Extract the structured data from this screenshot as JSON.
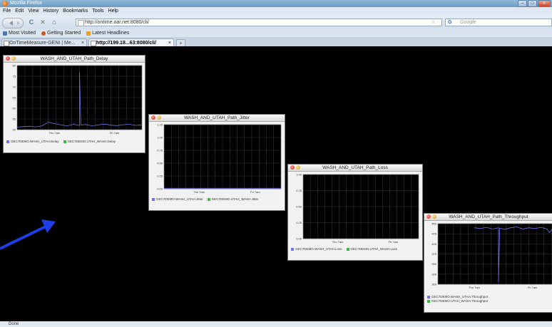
{
  "window": {
    "title": "Mozilla Firefox",
    "buttons": [
      "–",
      "□",
      "✕"
    ]
  },
  "menu": [
    "File",
    "Edit",
    "View",
    "History",
    "Bookmarks",
    "Tools",
    "Help"
  ],
  "nav": {
    "back_icon": "back-arrow-icon",
    "reload_glyph": "C",
    "stop_glyph": "✕",
    "home_glyph": "⌂",
    "url": "http://ontime.oar.net:8080/cli/",
    "bookmark_star": "☆ ·",
    "search_engine": "G",
    "search_placeholder": "Google"
  },
  "bookmarks": [
    {
      "label": "Most Visited",
      "icon": "most-visited-icon",
      "color": "#4a78b5"
    },
    {
      "label": "Getting Started",
      "icon": "firefox-icon",
      "color": "#d2541c"
    },
    {
      "label": "Latest Headlines",
      "icon": "rss-icon",
      "color": "#f0a020"
    }
  ],
  "tabs": [
    {
      "label": "OnTimeMeasure-GENI | Me...",
      "close": "×",
      "active": false
    },
    {
      "label": "http://199.18...63:8080/cli/",
      "close": "×",
      "active": true
    }
  ],
  "new_tab": "+",
  "status": "Done",
  "colors": {
    "series_primary": "#6f74e8",
    "series_secondary": "#39b54a",
    "grid": "#4a4a4a",
    "plot_bg": "#000000",
    "annotation_arrow": "#1f3fe6"
  },
  "chart_data": [
    {
      "type": "line",
      "title": "WASH_AND_UTAH_Path_Delay",
      "x_tick_labels": [
        "Thu 7am",
        "Fri 7am"
      ],
      "y_ticks": [
        50,
        55,
        60,
        65,
        70,
        75,
        80
      ],
      "ylim": [
        50,
        80
      ],
      "grid": true,
      "legend_layout": "row",
      "series": [
        {
          "name": "GEC7DEMO.WASH_UTAH.Delay",
          "color": "#6f74e8",
          "x": [
            0,
            0.05,
            0.1,
            0.15,
            0.2,
            0.25,
            0.3,
            0.35,
            0.4,
            0.45,
            0.5,
            0.5,
            0.51,
            0.55,
            0.6,
            0.65,
            0.7,
            0.75,
            0.8,
            0.85,
            0.9,
            0.95,
            1.0
          ],
          "values": [
            51.2,
            51.4,
            51.6,
            51.3,
            51.8,
            53.5,
            52.8,
            52.2,
            51.8,
            52.5,
            52.0,
            77,
            52.2,
            52.4,
            51.8,
            52.2,
            52.6,
            52.1,
            51.9,
            52.3,
            52.5,
            52.0,
            52.3
          ]
        },
        {
          "name": "GEC7DEMO.UTAH_WASH.Delay",
          "color": "#39b54a",
          "x": [],
          "values": []
        }
      ]
    },
    {
      "type": "line",
      "title": "WASH_AND_UTAH_Path_Jitter",
      "x_tick_labels": [
        "Thu 7am",
        "Fri 7am"
      ],
      "y_ticks": [
        "0.00",
        "0.25",
        "0.50",
        "0.75",
        "1.00",
        "1.25"
      ],
      "ylim": [
        0,
        1.25
      ],
      "grid": true,
      "legend_layout": "row",
      "series": [
        {
          "name": "GEC7DEMO.WASH_UTAH.Jitter",
          "color": "#6f74e8",
          "x": [
            0,
            0.1,
            0.2,
            0.3,
            0.4,
            0.5,
            0.6,
            0.7,
            0.8,
            0.9,
            1.0
          ],
          "values": [
            0.01,
            0.01,
            0.01,
            0.01,
            0.01,
            0.01,
            0.01,
            0.01,
            0.01,
            0.01,
            0.01
          ]
        },
        {
          "name": "GEC7DEMO.UTAH_WASH.Jitter",
          "color": "#39b54a",
          "x": [],
          "values": []
        }
      ]
    },
    {
      "type": "line",
      "title": "WASH_AND_UTAH_Path_Loss",
      "x_tick_labels": [
        "Thu 7am",
        "Fri 7am"
      ],
      "y_ticks": [
        "0.00",
        "0.25",
        "0.50",
        "0.75",
        "1.00"
      ],
      "ylim": [
        0,
        1.0
      ],
      "grid": true,
      "legend_layout": "row",
      "series": [
        {
          "name": "GEC7DEMO.WASH_UTAH.Loss",
          "color": "#6f74e8",
          "x": [],
          "values": []
        },
        {
          "name": "GEC7DEMO.UTAH_WASH.Loss",
          "color": "#39b54a",
          "x": [],
          "values": []
        }
      ]
    },
    {
      "type": "line",
      "title": "WASH_AND_UTAH_Path_Throughput",
      "x_tick_labels": [
        "Thu 7am",
        "Fri 7am"
      ],
      "y_ticks": [
        300,
        325,
        350,
        375,
        400,
        425,
        450
      ],
      "ylim": [
        300,
        450
      ],
      "grid": true,
      "legend_layout": "column",
      "series": [
        {
          "name": "GEC7DEMO.WASH_UTAH.Throughput",
          "color": "#6f74e8",
          "x": [
            0.3,
            0.35,
            0.4,
            0.45,
            0.5,
            0.5,
            0.51,
            0.55,
            0.6,
            0.65,
            0.7,
            0.75,
            0.8,
            0.85,
            0.9,
            0.92,
            0.95,
            1.0
          ],
          "values": [
            440,
            438,
            441,
            437,
            440,
            305,
            439,
            436,
            440,
            442,
            437,
            440,
            438,
            441,
            437,
            428,
            439,
            440
          ]
        },
        {
          "name": "GEC7DEMO.UTAH_WASH.Throughput",
          "color": "#39b54a",
          "x": [],
          "values": []
        }
      ]
    }
  ]
}
